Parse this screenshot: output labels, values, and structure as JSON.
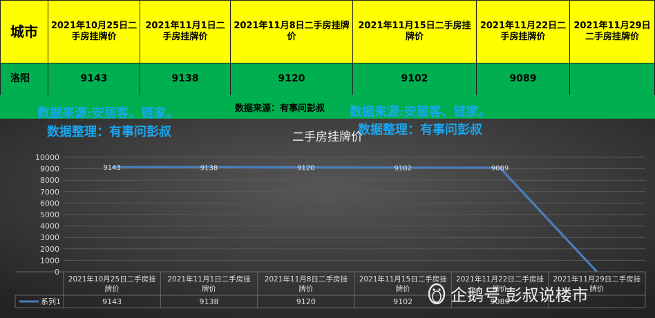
{
  "table": {
    "city_header": "城市",
    "columns": [
      "2021年10月25日二手房挂牌价",
      "2021年11月1日二手房挂牌价",
      "2021年11月8日二手房挂牌价",
      "2021年11月15日二手房挂牌价",
      "2021年11月22日二手房挂牌价",
      "2021年11月29日二手房挂牌价"
    ],
    "city": "洛阳",
    "values": [
      "9143",
      "9138",
      "9120",
      "9102",
      "9089",
      ""
    ]
  },
  "source_center": "数据来源：有事问彭叔",
  "watermarks": {
    "source": "数据来源:安居客、链家。",
    "curator": "数据整理：有事问彭叔"
  },
  "brand": "企鹅号 彭叔说楼市",
  "colors": {
    "header_bg": "#ffff00",
    "row_bg": "#00b050",
    "line": "#4a7ebb",
    "watermark": "#1aa6f0"
  },
  "chart_data": {
    "type": "line",
    "title": "二手房挂牌价",
    "categories": [
      "2021年10月25日二手房挂牌价",
      "2021年11月1日二手房挂牌价",
      "2021年11月8日二手房挂牌价",
      "2021年11月15日二手房挂牌价",
      "2021年11月22日二手房挂牌价",
      "2021年11月29日二手房挂牌价"
    ],
    "series": [
      {
        "name": "系列1",
        "values": [
          9143,
          9138,
          9120,
          9102,
          9089,
          0
        ]
      }
    ],
    "data_labels": [
      "9143",
      "9138",
      "9120",
      "9102",
      "9089",
      ""
    ],
    "table_values": [
      "9143",
      "9138",
      "9120",
      "9102",
      "9089",
      ""
    ],
    "ylim": [
      0,
      10000
    ],
    "yticks": [
      0,
      1000,
      2000,
      3000,
      4000,
      5000,
      6000,
      7000,
      8000,
      9000,
      10000
    ],
    "grid": true,
    "legend": "data-table"
  }
}
